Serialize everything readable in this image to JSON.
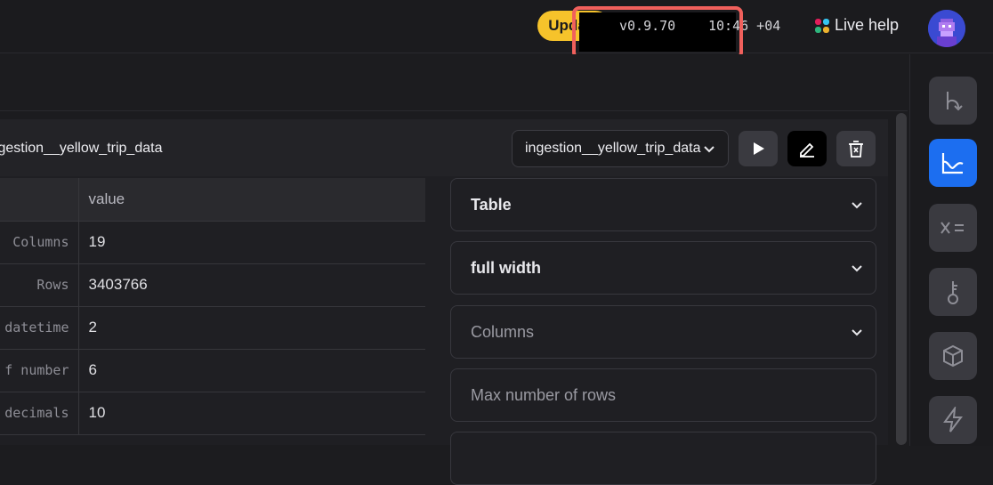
{
  "topbar": {
    "update_label": "Update",
    "version": "v0.9.70",
    "clock": "10:46 +04",
    "live_help": "Live help"
  },
  "block": {
    "title": "ingestion__yellow_trip_data",
    "selected_block": "ingestion__yellow_trip_data",
    "table": {
      "header_value": "value",
      "rows": [
        {
          "key": "Columns",
          "value": "19"
        },
        {
          "key": "Rows",
          "value": "3403766"
        },
        {
          "key": "datetime",
          "value": "2"
        },
        {
          "key": "f number",
          "value": "6"
        },
        {
          "key": "decimals",
          "value": "10"
        }
      ]
    },
    "config": [
      {
        "label": "Table"
      },
      {
        "label": "full width"
      },
      {
        "label": "Columns"
      },
      {
        "label": "Max number of rows"
      }
    ]
  },
  "colors": {
    "accent": "#1c6ef0",
    "update": "#f6c32b",
    "highlight": "#f0605c"
  }
}
